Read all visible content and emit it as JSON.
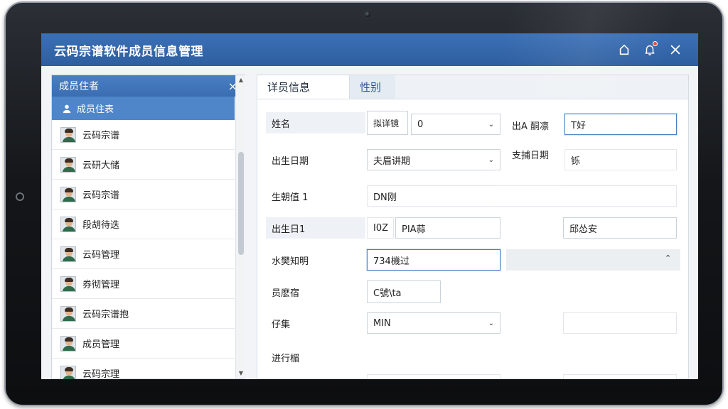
{
  "app": {
    "title": "云码宗谱软件成员信息管理",
    "icons": [
      "home-icon",
      "bell-icon",
      "close-icon"
    ],
    "accent": "#2d5e9f"
  },
  "left_panel": {
    "title": "成员住者",
    "close_glyph": "×",
    "subheader": "成员住表",
    "members": [
      "云码宗谱",
      "云研大储",
      "云码宗谱",
      "段胡待迭",
      "云码管理",
      "券彻管理",
      "云码宗谱抱",
      "成员管理",
      "云码宗理"
    ]
  },
  "right_panel": {
    "tabs": [
      "详员信息",
      "性别"
    ],
    "rows": {
      "r1": {
        "label": "姓名",
        "box": "拟详镜",
        "select": "0",
        "right_label": "出A 酮凛",
        "right_value": "T好"
      },
      "r2": {
        "label": "出生日期",
        "select": "夫眉讲期",
        "right_label": "支捕日期",
        "right_value": "铄"
      },
      "r3": {
        "label": "生朝值 1",
        "value": "DN刚"
      },
      "r4": {
        "label": "出生日1",
        "code": "I0Z",
        "value": "PIA蒜",
        "right_value": "邱怂安"
      },
      "r5": {
        "label": "水樊知明",
        "value": "734機过"
      },
      "r6": {
        "label": "员麽宿",
        "value": "C號\\ta"
      },
      "r7": {
        "label": "仔集",
        "select": "MIN"
      },
      "r8": {
        "label": "进行楣"
      }
    }
  }
}
